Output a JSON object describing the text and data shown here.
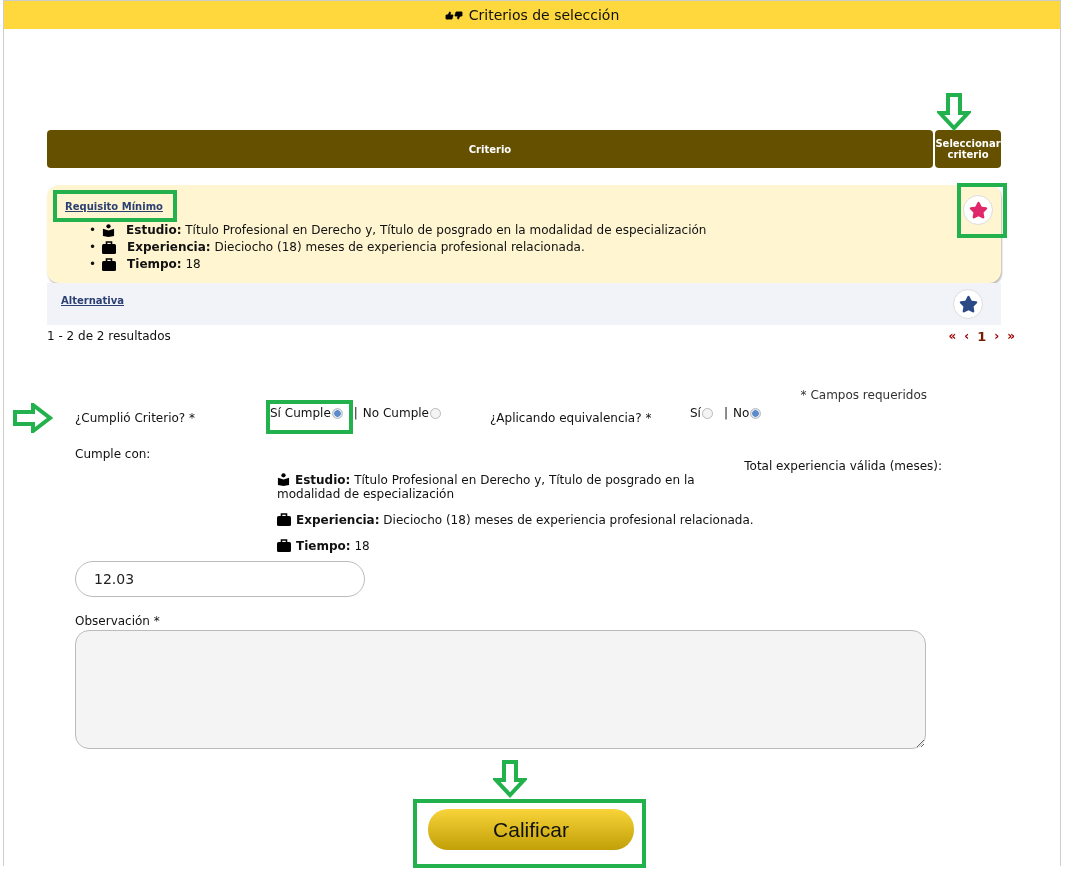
{
  "header": {
    "title": "Criterios de selección"
  },
  "table": {
    "columns": [
      "Criterio",
      "Seleccionar criterio"
    ],
    "rows": [
      {
        "name": "Requisito Mínimo",
        "selected": true,
        "color": "#e0276a",
        "details": [
          {
            "marker": "•",
            "kind": "study",
            "label": "Estudio:",
            "text": "Título Profesional en Derecho y, Título de posgrado en la modalidad de especialización"
          },
          {
            "marker": "•",
            "kind": "job",
            "label": "Experiencia:",
            "text": "Dieciocho (18) meses de experiencia profesional relacionada."
          },
          {
            "marker": "•",
            "kind": "job",
            "label": "Tiempo:",
            "text": "18"
          }
        ]
      },
      {
        "name": "Alternativa",
        "selected": false,
        "color": "#2b4a85",
        "details": []
      }
    ]
  },
  "results": "1 - 2 de 2 resultados",
  "pagination": [
    {
      "label": "«",
      "selected": false
    },
    {
      "label": "‹",
      "selected": false
    },
    {
      "label": "1",
      "selected": true
    },
    {
      "label": "›",
      "selected": false
    },
    {
      "label": "»",
      "selected": false
    }
  ],
  "form": {
    "required_note": "* Campos requeridos",
    "question_1": {
      "label": "¿Cumplió Criterio? *",
      "separator": "|",
      "options": [
        {
          "label": "Sí Cumple",
          "selected": true
        },
        {
          "label": "No Cumple",
          "selected": false
        }
      ]
    },
    "question_2": {
      "label": "¿Aplicando equivalencia? *",
      "separator": "|",
      "options": [
        {
          "label": "Sí",
          "selected": false
        },
        {
          "label": "No",
          "selected": true
        }
      ]
    },
    "cumple_label": "Cumple con:",
    "total_label": "Total experiencia válida (meses):",
    "cumple_items": [
      {
        "kind": "study",
        "label": "Estudio:",
        "text": "Título Profesional en Derecho y, Título de posgrado en la modalidad de especialización"
      },
      {
        "kind": "job",
        "label": "Experiencia:",
        "text": "Dieciocho (18) meses de experiencia profesional relacionada."
      },
      {
        "kind": "job",
        "label": "Tiempo:",
        "text": "18"
      }
    ],
    "total_value": "12.03",
    "observation_label": "Observación *",
    "submit": "Calificar"
  }
}
